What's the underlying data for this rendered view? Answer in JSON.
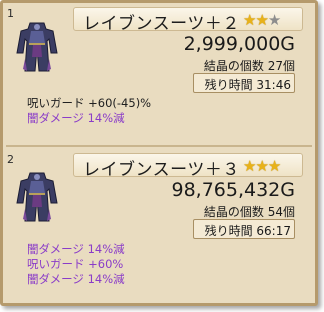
{
  "entries": [
    {
      "index": "1",
      "name": "レイブンスーツ＋２",
      "stars_filled": 2,
      "stars_total": 3,
      "price": "2,999,000G",
      "crystals": "結晶の個数 27個",
      "time_left": "残り時間 31:46",
      "effects": [
        {
          "text": "呪いガード +60(-45)%",
          "color": "#202020"
        },
        {
          "text": "闇ダメージ 14%減",
          "color": "#8a3cc8"
        }
      ]
    },
    {
      "index": "2",
      "name": "レイブンスーツ＋３",
      "stars_filled": 3,
      "stars_total": 3,
      "price": "98,765,432G",
      "crystals": "結晶の個数 54個",
      "time_left": "残り時間 66:17",
      "effects": [
        {
          "text": "闇ダメージ 14%減",
          "color": "#8a3cc8"
        },
        {
          "text": "呪いガード +60%",
          "color": "#8a3cc8"
        },
        {
          "text": "闇ダメージ 14%減",
          "color": "#8a3cc8"
        }
      ]
    }
  ],
  "colors": {
    "panel_bg": "#e9dcc0",
    "border": "#b59a6c",
    "star_on": "#e8b21a",
    "star_off": "#8d8d8d",
    "effect_purple": "#8a3cc8"
  },
  "icons": {
    "item_thumbnail": "armor-suit-icon",
    "star": "star-icon"
  }
}
